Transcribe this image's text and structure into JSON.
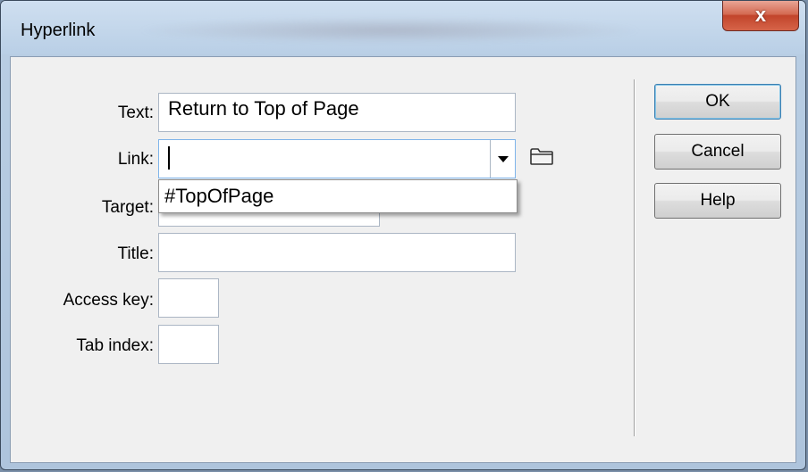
{
  "window": {
    "title": "Hyperlink",
    "close_glyph": "x"
  },
  "form": {
    "text_label": "Text:",
    "text_value": "Return to Top of Page",
    "link_label": "Link:",
    "link_value": "",
    "link_suggestion": "#TopOfPage",
    "target_label": "Target:",
    "title_label": "Title:",
    "title_value": "",
    "access_key_label": "Access key:",
    "access_key_value": "",
    "tab_index_label": "Tab index:",
    "tab_index_value": ""
  },
  "buttons": {
    "ok": "OK",
    "cancel": "Cancel",
    "help": "Help"
  },
  "icons": {
    "browse": "folder-icon",
    "dropdown": "chevron-down-icon",
    "close": "close-icon"
  }
}
